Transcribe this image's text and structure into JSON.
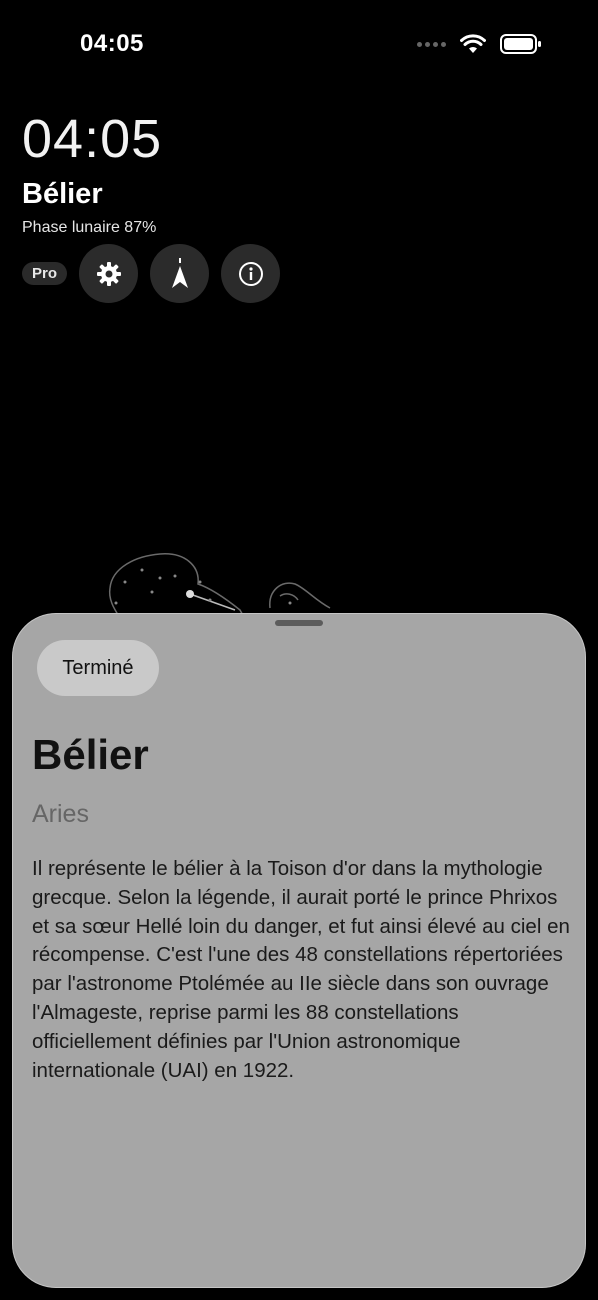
{
  "status_bar": {
    "time": "04:05",
    "icons": [
      "signal-icon",
      "wifi-icon",
      "battery-icon"
    ]
  },
  "clock": {
    "time": "04:05"
  },
  "constellation": {
    "name": "Bélier",
    "phase": "Phase lunaire 87%"
  },
  "controls": {
    "pro_label": "Pro",
    "icons": [
      "gear-icon",
      "compass-icon",
      "info-icon"
    ]
  },
  "sheet": {
    "done_label": "Terminé",
    "title": "Bélier",
    "subtitle": "Aries",
    "description": "Il représente le bélier à la Toison d'or dans la mythologie grecque. Selon la légende, il aurait porté le prince Phrixos et sa sœur Hellé loin du danger, et fut ainsi élevé au ciel en récompense. C'est l'une des 48 constellations répertoriées par l'astronome Ptolémée au IIe siècle dans son ouvrage l'Almageste, reprise parmi les 88 constellations officiellement définies par l'Union astronomique internationale (UAI) en 1922."
  },
  "colors": {
    "background": "#000000",
    "sheet": "#a6a6a6",
    "button": "#2b2b2b"
  }
}
